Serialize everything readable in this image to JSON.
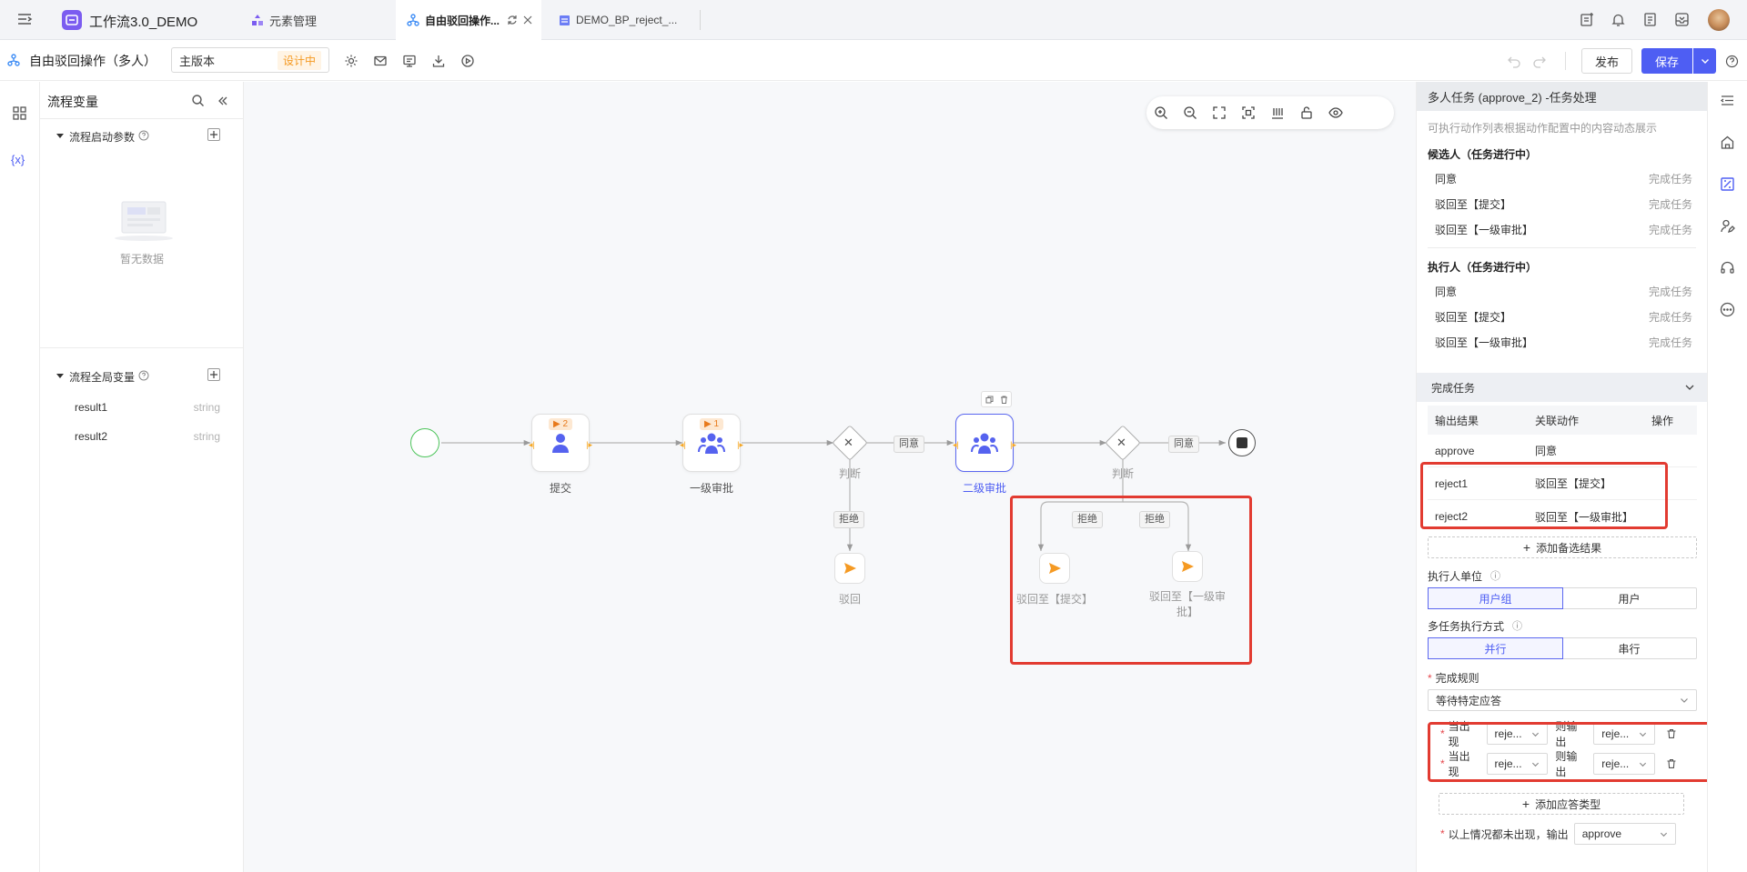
{
  "app": {
    "title": "工作流3.0_DEMO"
  },
  "tabs": [
    {
      "label": "元素管理"
    },
    {
      "label": "自由驳回操作..."
    },
    {
      "label": "DEMO_BP_reject_..."
    }
  ],
  "toolbar": {
    "process_name": "自由驳回操作（多人）",
    "version": "主版本",
    "status": "设计中",
    "publish": "发布",
    "save": "保存"
  },
  "left_panel": {
    "title": "流程变量",
    "start_params": "流程启动参数",
    "empty": "暂无数据",
    "global_vars": "流程全局变量",
    "vars": [
      {
        "name": "result1",
        "type": "string"
      },
      {
        "name": "result2",
        "type": "string"
      }
    ]
  },
  "left_rail": {
    "var_icon": "{x}"
  },
  "canvas": {
    "nodes": {
      "submit": {
        "label": "提交",
        "badge": "2"
      },
      "level1": {
        "label": "一级审批",
        "badge": "1"
      },
      "judge1": {
        "label": "判断"
      },
      "level2": {
        "label": "二级审批"
      },
      "judge2": {
        "label": "判断"
      },
      "reject": {
        "label": "驳回"
      },
      "reject_submit": {
        "label": "驳回至【提交】"
      },
      "reject_level1": {
        "label": "驳回至【一级审批】"
      }
    },
    "edges": {
      "agree1": "同意",
      "refuse1": "拒绝",
      "agree2": "同意",
      "refuse2a": "拒绝",
      "refuse2b": "拒绝"
    }
  },
  "right_panel": {
    "header": "多人任务 (approve_2) -任务处理",
    "hint": "可执行动作列表根据动作配置中的内容动态展示",
    "candidates_title": "候选人（任务进行中）",
    "candidates": [
      {
        "action": "同意",
        "status": "完成任务"
      },
      {
        "action": "驳回至【提交】",
        "status": "完成任务"
      },
      {
        "action": "驳回至【一级审批】",
        "status": "完成任务"
      }
    ],
    "executors_title": "执行人（任务进行中）",
    "executors": [
      {
        "action": "同意",
        "status": "完成任务"
      },
      {
        "action": "驳回至【提交】",
        "status": "完成任务"
      },
      {
        "action": "驳回至【一级审批】",
        "status": "完成任务"
      }
    ],
    "complete_section": "完成任务",
    "table_headers": {
      "output": "输出结果",
      "action": "关联动作",
      "op": "操作"
    },
    "rows": [
      {
        "output": "approve",
        "action": "同意"
      },
      {
        "output": "reject1",
        "action": "驳回至【提交】"
      },
      {
        "output": "reject2",
        "action": "驳回至【一级审批】"
      }
    ],
    "add_result": "添加备选结果",
    "exec_unit_label": "执行人单位",
    "exec_unit_options": [
      "用户组",
      "用户"
    ],
    "multi_mode_label": "多任务执行方式",
    "multi_mode_options": [
      "并行",
      "串行"
    ],
    "complete_rule_label": "完成规则",
    "complete_rule_value": "等待特定应答",
    "rules": [
      {
        "when": "当出现",
        "val": "reje...",
        "then": "则输出",
        "out": "reje..."
      },
      {
        "when": "当出现",
        "val": "reje...",
        "then": "则输出",
        "out": "reje..."
      }
    ],
    "add_response": "添加应答类型",
    "default_label": "以上情况都未出现，输出",
    "default_value": "approve"
  }
}
